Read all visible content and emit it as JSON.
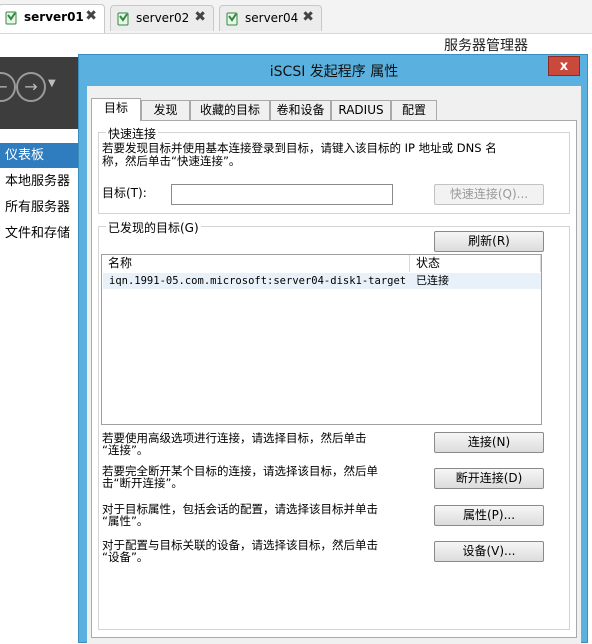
{
  "browser_tabs": [
    {
      "label": "server01",
      "active": true
    },
    {
      "label": "server02",
      "active": false
    },
    {
      "label": "server04",
      "active": false
    }
  ],
  "server_manager": {
    "title": "服务器管理器",
    "sidebar": [
      "仪表板",
      "本地服务器",
      "所有服务器",
      "文件和存储"
    ]
  },
  "dialog": {
    "title": "iSCSI 发起程序 属性",
    "close": "x",
    "tabs": [
      "目标",
      "发现",
      "收藏的目标",
      "卷和设备",
      "RADIUS",
      "配置"
    ],
    "quick_connect": {
      "group_label": "快速连接",
      "description_line1": "若要发现目标并使用基本连接登录到目标，请键入该目标的 IP 地址或 DNS 名",
      "description_line2": "称，然后单击“快速连接”。",
      "target_label": "目标(T):",
      "target_value": "",
      "button": "快速连接(Q)..."
    },
    "discovered": {
      "group_label": "已发现的目标(G)",
      "refresh_button": "刷新(R)",
      "columns": [
        "名称",
        "状态"
      ],
      "rows": [
        {
          "name": "iqn.1991-05.com.microsoft:server04-disk1-target",
          "status": "已连接"
        }
      ]
    },
    "actions": [
      {
        "line1": "若要使用高级选项进行连接，请选择目标，然后单击",
        "line2": "“连接”。",
        "button": "连接(N)"
      },
      {
        "line1": "若要完全断开某个目标的连接，请选择该目标，然后单",
        "line2": "击“断开连接”。",
        "button": "断开连接(D)"
      },
      {
        "line1": "对于目标属性，包括会话的配置，请选择该目标并单击",
        "line2": "“属性”。",
        "button": "属性(P)..."
      },
      {
        "line1": "对于配置与目标关联的设备，请选择该目标，然后单击",
        "line2": "“设备”。",
        "button": "设备(V)..."
      }
    ]
  },
  "colors": {
    "dialog_frame": "#5ab0de",
    "close_button": "#c94a3c",
    "sidebar_active": "#2f7dbf",
    "nav_dark": "#3d3d3d"
  }
}
